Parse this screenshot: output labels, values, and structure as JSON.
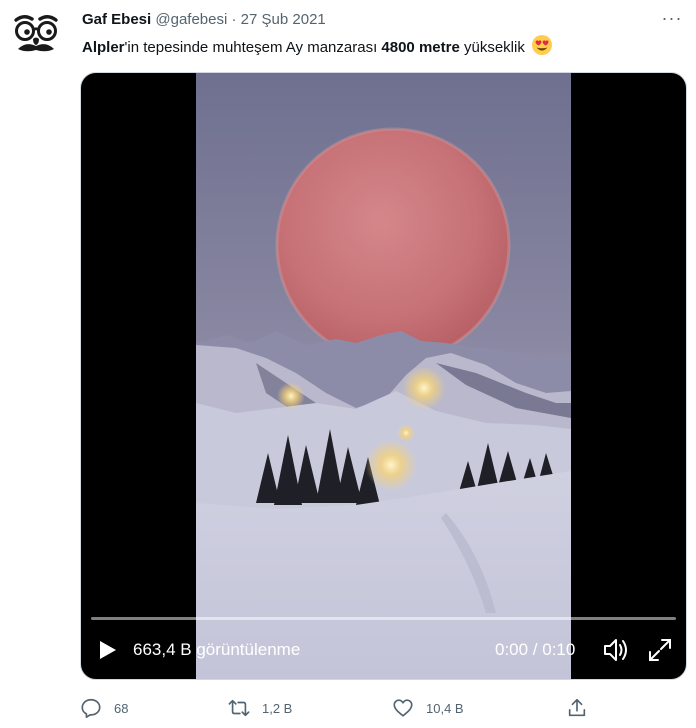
{
  "tweet": {
    "author_name": "Gaf Ebesi",
    "author_handle": "@gafebesi",
    "separator": "·",
    "date": "27 Şub 2021",
    "more_label": "···",
    "text_bold_1": "Alpler",
    "text_part_1": "'in tepesinde muhteşem Ay manzarası ",
    "text_bold_2": "4800 metre",
    "text_part_2": " yükseklik",
    "emoji": "heart-eyes-emoji"
  },
  "video": {
    "views": "663,4 B görüntülenme",
    "time": "0:00 / 0:10",
    "progress": 0
  },
  "actions": {
    "replies": "68",
    "retweets": "1,2 B",
    "likes": "10,4 B"
  },
  "colors": {
    "text": "#0f1419",
    "muted": "#536471",
    "moon": "#c9787c",
    "sky": "#7d7e98"
  }
}
